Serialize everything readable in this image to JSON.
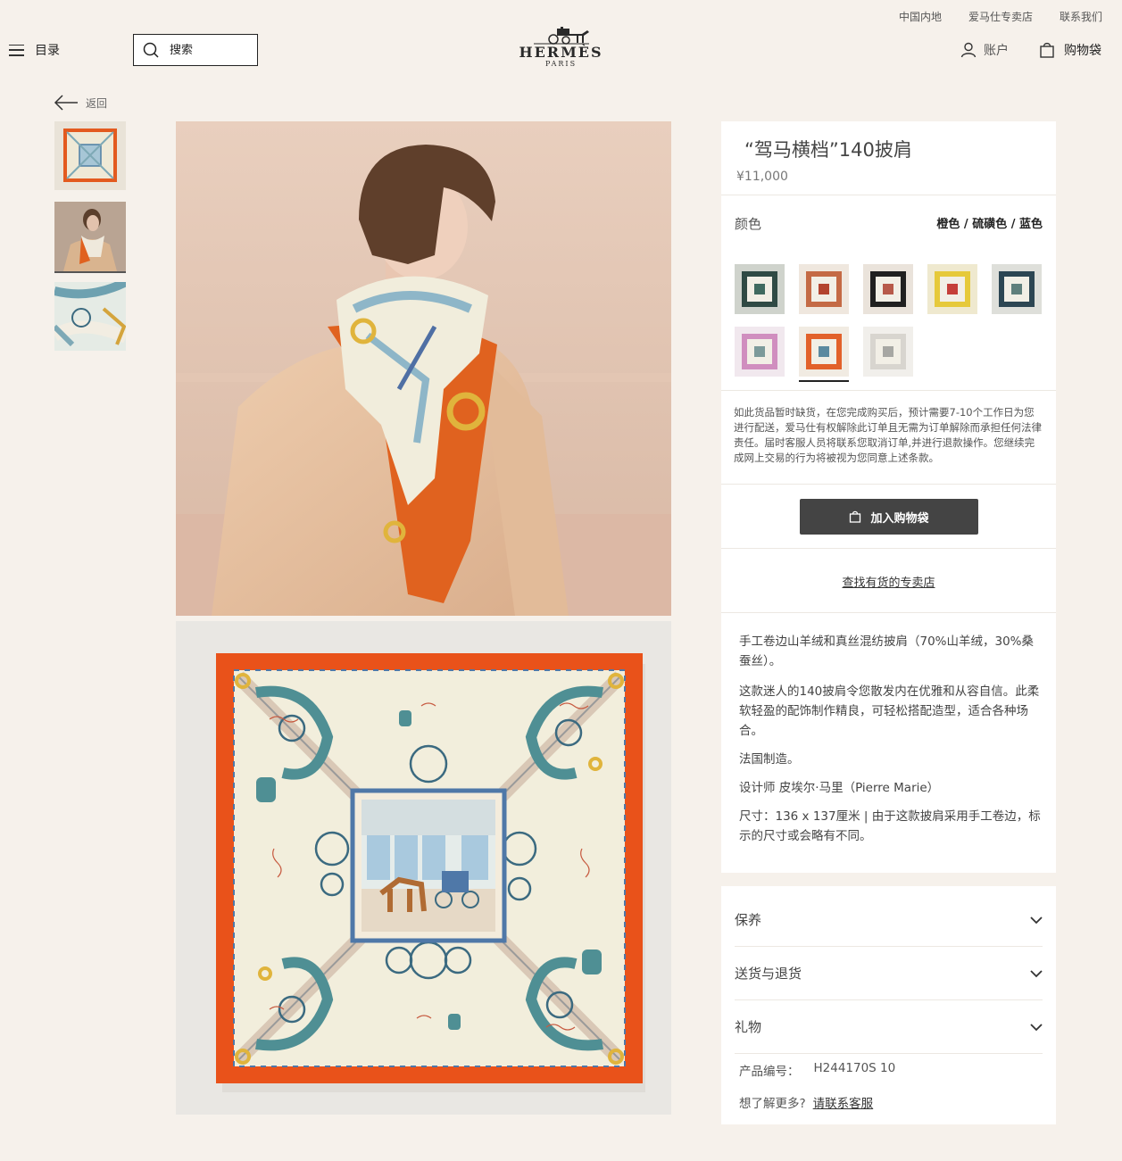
{
  "util_links": [
    "中国内地",
    "爱马仕专卖店",
    "联系我们"
  ],
  "header": {
    "menu_label": "目录",
    "search_placeholder": "搜索",
    "logo_word": "HERMÈS",
    "logo_sub": "PARIS",
    "account_label": "账户",
    "bag_label": "购物袋"
  },
  "back_label": "返回",
  "product": {
    "title": "“驾马横档”140披肩",
    "price": "¥11,000",
    "color_label": "颜色",
    "color_value": "橙色 / 硫磺色 / 蓝色",
    "swatches": [
      {
        "name": "dark-green",
        "border": "#2f4a44",
        "center": "#3f6a60",
        "bg": "#cfd3cc"
      },
      {
        "name": "orange-pink",
        "border": "#c46a45",
        "center": "#b3442f",
        "bg": "#efe7de"
      },
      {
        "name": "black",
        "border": "#202020",
        "center": "#b75a4a",
        "bg": "#eae3db"
      },
      {
        "name": "yellow",
        "border": "#e6c93a",
        "center": "#c53f3a",
        "bg": "#efe9cf"
      },
      {
        "name": "navy-teal",
        "border": "#2c4653",
        "center": "#5f7f7c",
        "bg": "#dedfda"
      },
      {
        "name": "pink",
        "border": "#d08ebf",
        "center": "#7c9a9a",
        "bg": "#f1e8ee"
      },
      {
        "name": "orange-selected",
        "border": "#e2612a",
        "center": "#5c8aa0",
        "bg": "#f1ebe2"
      },
      {
        "name": "light-grey",
        "border": "#d8d5cf",
        "center": "#a7a7a3",
        "bg": "#f1efeb"
      }
    ],
    "selected_swatch": 6,
    "notice": "如此货品暂时缺货，在您完成购买后，预计需要7-10个工作日为您进行配送，爱马仕有权解除此订单且无需为订单解除而承担任何法律责任。届时客服人员将联系您取消订单,并进行退款操作。您继续完成网上交易的行为将被视为您同意上述条款。",
    "add_to_bag": "加入购物袋",
    "find_store": "查找有货的专卖店",
    "description": [
      "手工卷边山羊绒和真丝混纺披肩（70%山羊绒，30%桑蚕丝）。",
      "这款迷人的140披肩令您散发内在优雅和从容自信。此柔软轻盈的配饰制作精良，可轻松搭配造型，适合各种场合。",
      "法国制造。",
      "设计师 皮埃尔·马里（Pierre Marie）",
      "尺寸：136 x 137厘米 | 由于这款披肩采用手工卷边，标示的尺寸或会略有不同。"
    ],
    "accordion": [
      "保养",
      "送货与退货",
      "礼物"
    ],
    "sku_label": "产品编号：",
    "sku_value": "H244170S 10",
    "help_question": "想了解更多?",
    "help_link": "请联系客服"
  }
}
